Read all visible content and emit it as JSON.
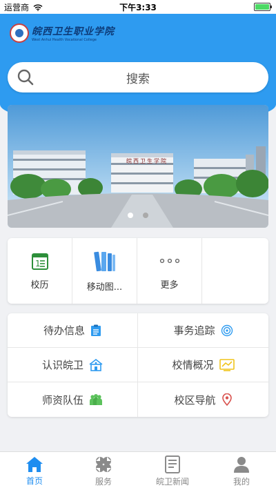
{
  "status": {
    "carrier": "运营商",
    "time": "下午3:33"
  },
  "header": {
    "logo_cn": "皖西卫生职业学院",
    "logo_en": "West Anhui Health Vocational College"
  },
  "search": {
    "label": "搜索"
  },
  "banner": {
    "building_sign": "皖西卫生学院",
    "page_count": 2,
    "current_page": 1
  },
  "grid1": [
    {
      "label": "校历",
      "icon": "calendar-icon"
    },
    {
      "label": "移动图...",
      "icon": "books-icon"
    },
    {
      "label": "更多",
      "icon": "more-icon"
    }
  ],
  "grid2": [
    {
      "label": "待办信息",
      "icon": "clipboard-icon",
      "color": "#2e9bf0"
    },
    {
      "label": "事务追踪",
      "icon": "target-icon",
      "color": "#2e9bf0"
    },
    {
      "label": "认识皖卫",
      "icon": "school-icon",
      "color": "#2e9bf0"
    },
    {
      "label": "校情概况",
      "icon": "chart-icon",
      "color": "#f0c419"
    },
    {
      "label": "师资队伍",
      "icon": "people-icon",
      "color": "#5cc25c"
    },
    {
      "label": "校区导航",
      "icon": "location-icon",
      "color": "#d9534f"
    }
  ],
  "tabs": [
    {
      "label": "首页",
      "icon": "home-icon",
      "active": true
    },
    {
      "label": "服务",
      "icon": "clover-icon",
      "active": false
    },
    {
      "label": "皖卫新闻",
      "icon": "news-icon",
      "active": false
    },
    {
      "label": "我的",
      "icon": "user-icon",
      "active": false
    }
  ],
  "colors": {
    "primary": "#2e9bf0",
    "tab_active": "#1e8df0"
  }
}
